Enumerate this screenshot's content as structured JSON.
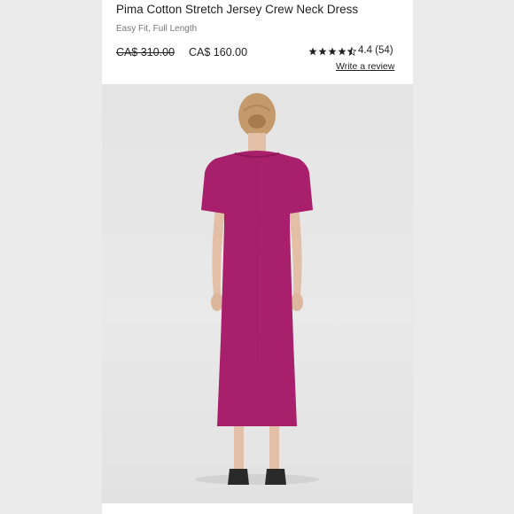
{
  "product": {
    "title": "Pima Cotton Stretch Jersey Crew Neck Dress",
    "subtitle": "Easy Fit, Full Length",
    "original_price": "CA$ 310.00",
    "sale_price": "CA$ 160.00",
    "rating": {
      "stars": 4.4,
      "text": "4.4 (54)",
      "write_review": "Write a review"
    }
  },
  "photo": {
    "dress_color": "#a8206b",
    "background_color": "#e6e6e6"
  },
  "colors": {
    "text_primary": "#222222",
    "text_secondary": "#777777",
    "page_background": "#ebebeb"
  }
}
